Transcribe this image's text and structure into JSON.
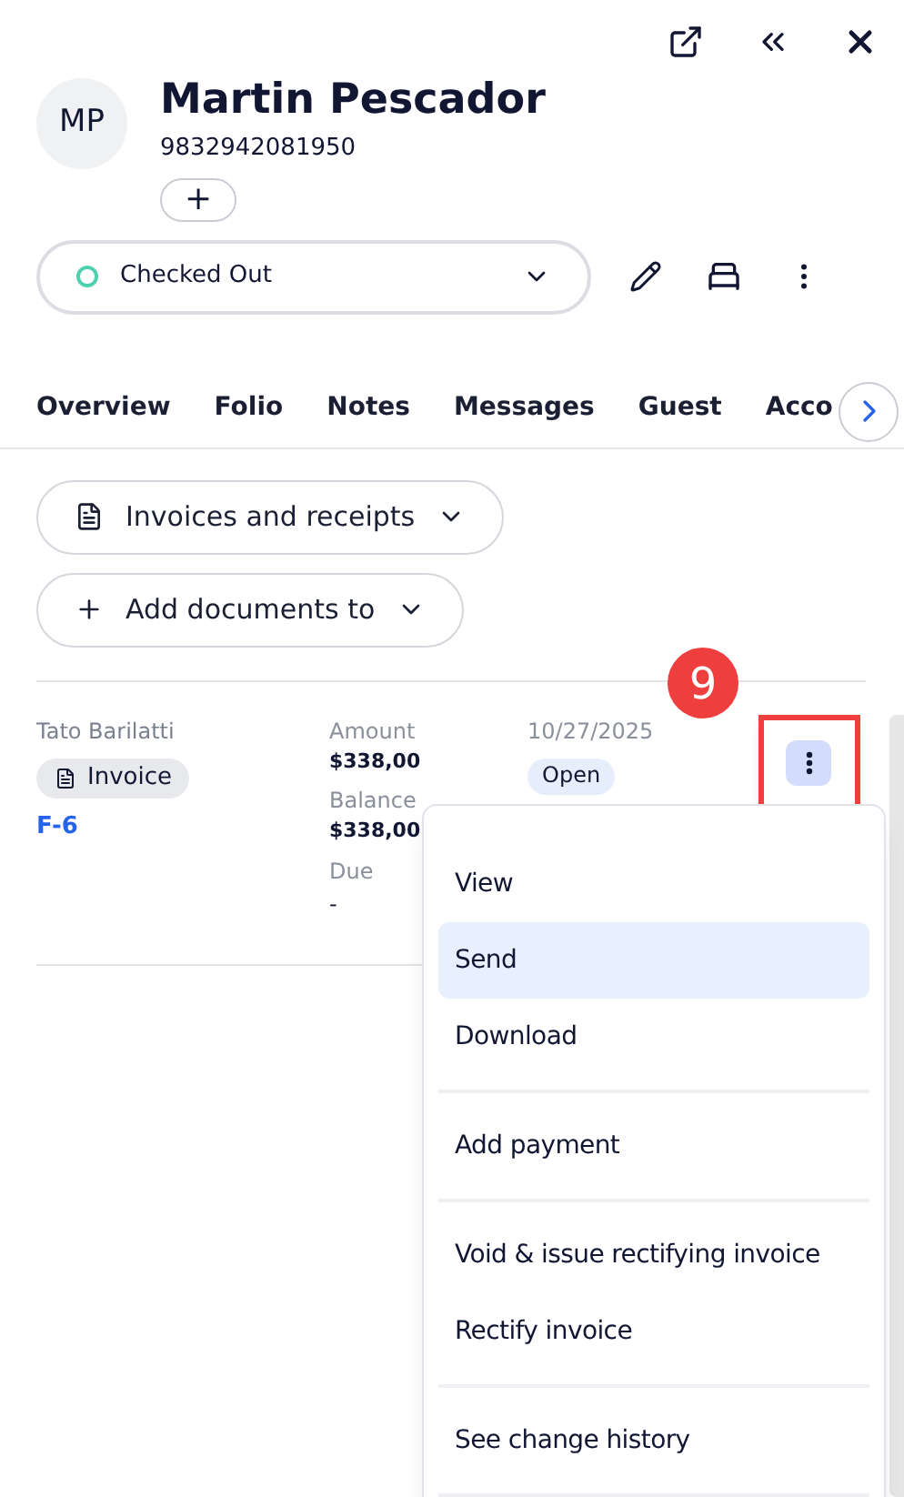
{
  "guest": {
    "initials": "MP",
    "name": "Martin Pescador",
    "phone": "9832942081950",
    "add_label": "+"
  },
  "status": {
    "label": "Checked Out"
  },
  "tabs": [
    {
      "label": "Overview",
      "selected": false
    },
    {
      "label": "Folio",
      "selected": false
    },
    {
      "label": "Notes",
      "selected": false
    },
    {
      "label": "Messages",
      "selected": false
    },
    {
      "label": "Guest",
      "selected": false
    },
    {
      "label": "Acco",
      "selected": false
    }
  ],
  "filters": [
    {
      "kind": "document",
      "label": "Invoices and receipts"
    },
    {
      "kind": "add",
      "label": "Add documents to"
    }
  ],
  "document": {
    "issuer": "Tato Barilatti",
    "type": "Invoice",
    "number": "F-6",
    "amount_label": "Amount",
    "amount": "$338,00",
    "balance_label": "Balance",
    "balance": "$338,00",
    "due_label": "Due",
    "due": "-",
    "date": "10/27/2025",
    "status": "Open"
  },
  "callout": {
    "number": "9"
  },
  "menu": [
    [
      {
        "label": "View",
        "selected": false
      },
      {
        "label": "Send",
        "selected": true
      },
      {
        "label": "Download",
        "selected": false
      }
    ],
    [
      {
        "label": "Add payment",
        "selected": false
      }
    ],
    [
      {
        "label": "Void & issue rectifying invoice",
        "selected": false
      },
      {
        "label": "Rectify invoice",
        "selected": false
      }
    ],
    [
      {
        "label": "See change history",
        "selected": false
      }
    ]
  ]
}
